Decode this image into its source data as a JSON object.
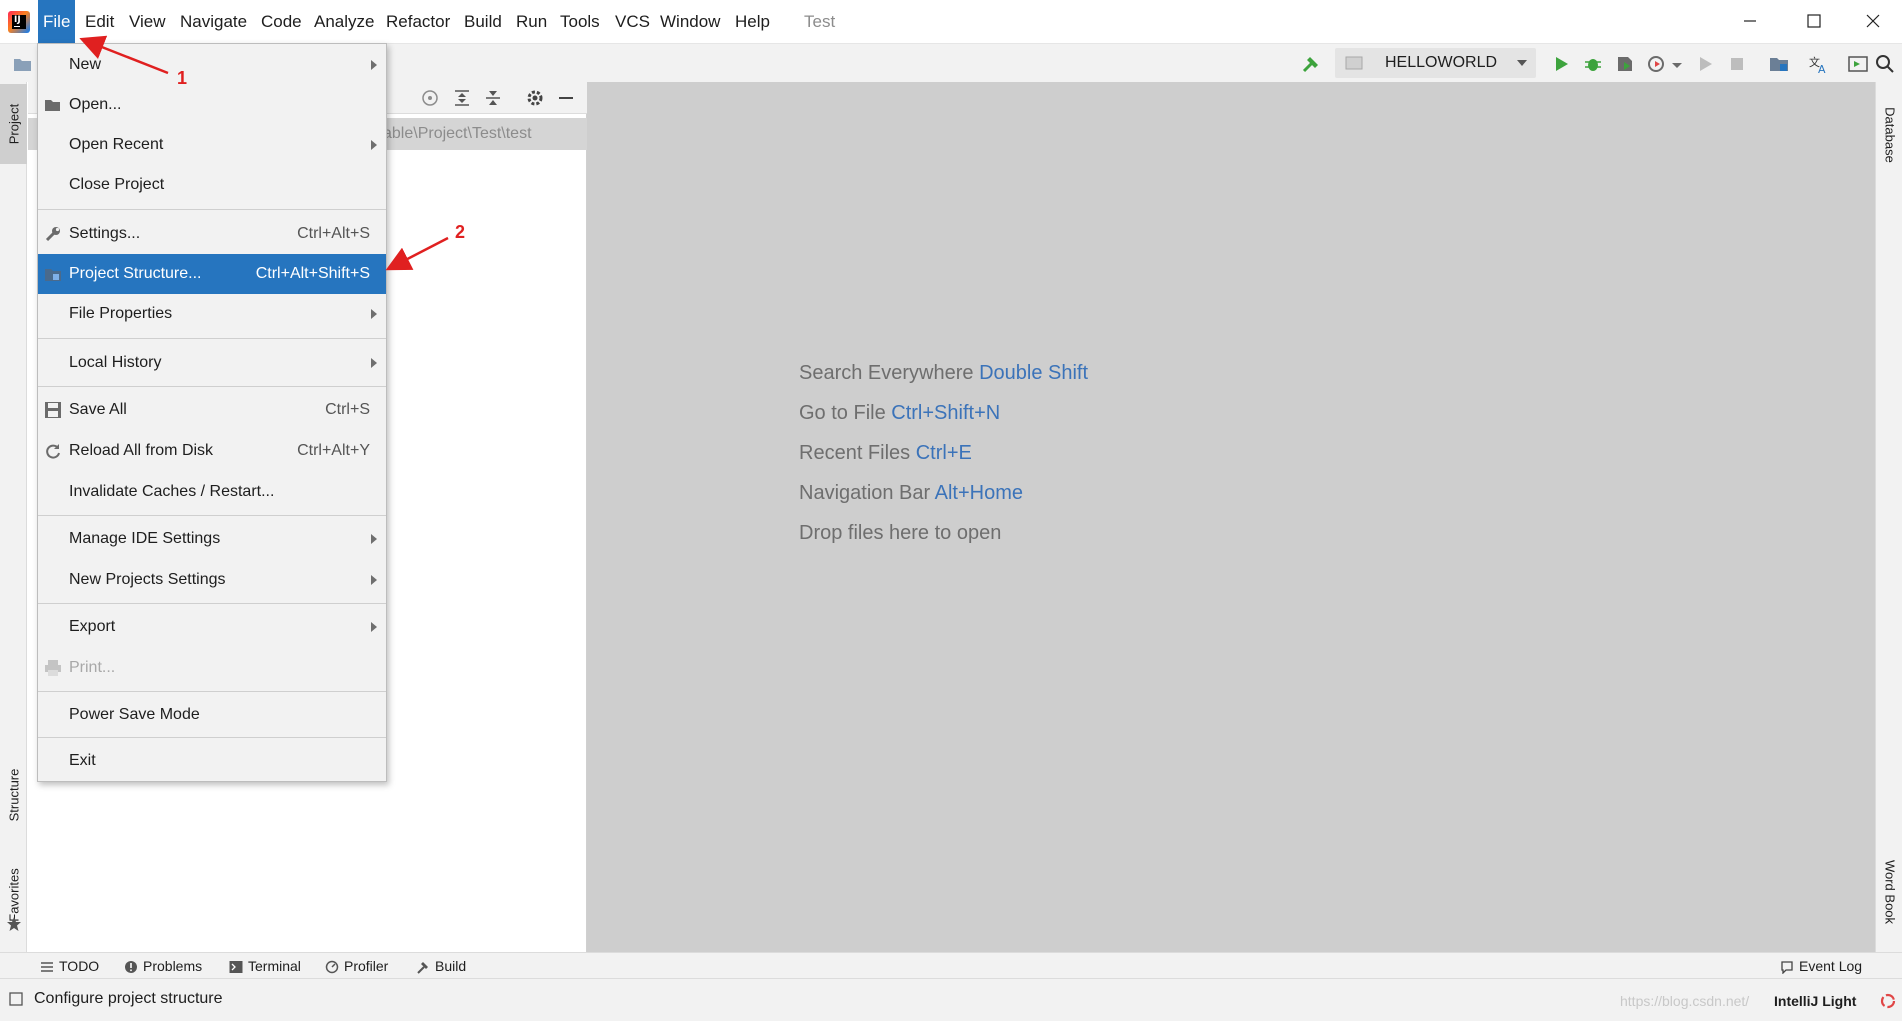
{
  "menubar": {
    "items": [
      "File",
      "Edit",
      "View",
      "Navigate",
      "Code",
      "Analyze",
      "Refactor",
      "Build",
      "Run",
      "Tools",
      "VCS",
      "Window",
      "Help"
    ],
    "project_name": "Test"
  },
  "toolbar": {
    "run_config": "HELLOWORLD"
  },
  "left_strip": {
    "project_tab": "Project",
    "structure_tab": "Structure",
    "favorites_tab": "Favorites"
  },
  "right_strip": {
    "database_tab": "Database",
    "wordbook_tab": "Word Book"
  },
  "project_panel": {
    "path": "able\\Project\\Test\\test"
  },
  "file_menu": {
    "items": [
      {
        "label": "New",
        "shortcut": "",
        "submenu": true
      },
      {
        "label": "Open...",
        "shortcut": "",
        "submenu": false
      },
      {
        "label": "Open Recent",
        "shortcut": "",
        "submenu": true
      },
      {
        "label": "Close Project",
        "shortcut": "",
        "submenu": false
      },
      {
        "label": "Settings...",
        "shortcut": "Ctrl+Alt+S",
        "submenu": false
      },
      {
        "label": "Project Structure...",
        "shortcut": "Ctrl+Alt+Shift+S",
        "submenu": false,
        "selected": true
      },
      {
        "label": "File Properties",
        "shortcut": "",
        "submenu": true
      },
      {
        "label": "Local History",
        "shortcut": "",
        "submenu": true
      },
      {
        "label": "Save All",
        "shortcut": "Ctrl+S",
        "submenu": false
      },
      {
        "label": "Reload All from Disk",
        "shortcut": "Ctrl+Alt+Y",
        "submenu": false
      },
      {
        "label": "Invalidate Caches / Restart...",
        "shortcut": "",
        "submenu": false
      },
      {
        "label": "Manage IDE Settings",
        "shortcut": "",
        "submenu": true
      },
      {
        "label": "New Projects Settings",
        "shortcut": "",
        "submenu": true
      },
      {
        "label": "Export",
        "shortcut": "",
        "submenu": true
      },
      {
        "label": "Print...",
        "shortcut": "",
        "submenu": false,
        "disabled": true
      },
      {
        "label": "Power Save Mode",
        "shortcut": "",
        "submenu": false
      },
      {
        "label": "Exit",
        "shortcut": "",
        "submenu": false
      }
    ]
  },
  "editor": {
    "hints": [
      {
        "text": "Search Everywhere",
        "key": "Double Shift"
      },
      {
        "text": "Go to File",
        "key": "Ctrl+Shift+N"
      },
      {
        "text": "Recent Files",
        "key": "Ctrl+E"
      },
      {
        "text": "Navigation Bar",
        "key": "Alt+Home"
      },
      {
        "text": "Drop files here to open",
        "key": ""
      }
    ]
  },
  "bottom_tabs": {
    "todo": "TODO",
    "problems": "Problems",
    "terminal": "Terminal",
    "profiler": "Profiler",
    "build": "Build",
    "event_log": "Event Log"
  },
  "statusbar": {
    "message": "Configure project structure",
    "theme": "IntelliJ Light",
    "watermark": "https://blog.csdn.net/"
  },
  "annotations": {
    "step1": "1",
    "step2": "2"
  },
  "colors": {
    "selection": "#2675bf",
    "shortcut_link": "#3b73b9",
    "annotation": "#e02020",
    "run_green": "#3da33d"
  }
}
